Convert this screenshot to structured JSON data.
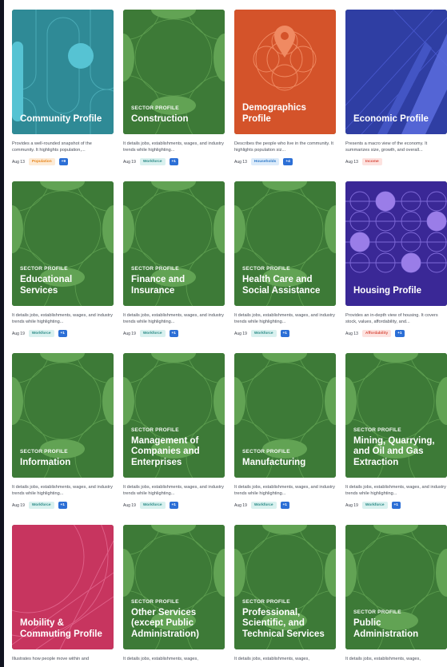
{
  "cards": [
    {
      "kicker": "",
      "title": "Community Profile",
      "desc": "Provides a well-rounded snapshot of the community. It highlights population,...",
      "date": "Aug 13",
      "tag": "Population",
      "tag_color": "#e8871e",
      "tag_bg": "#fdebd6",
      "plus": "+9",
      "theme": "community"
    },
    {
      "kicker": "SECTOR PROFILE",
      "title": "Construction",
      "desc": "It details jobs, establishments, wages, and industry trends while highlighting...",
      "date": "Aug 19",
      "tag": "Workforce",
      "tag_color": "#2a8a86",
      "tag_bg": "#d9f1ef",
      "plus": "+1",
      "theme": "sector"
    },
    {
      "kicker": "",
      "title": "Demographics Profile",
      "desc": "Describes the people who live in the community. It highlights population siz...",
      "date": "Aug 13",
      "tag": "Households",
      "tag_color": "#2e79c7",
      "tag_bg": "#dcebfa",
      "plus": "+4",
      "theme": "demographics"
    },
    {
      "kicker": "",
      "title": "Economic Profile",
      "desc": "Presents a macro view of the economy. It summarizes size, growth, and overall...",
      "date": "Aug 13",
      "tag": "Income",
      "tag_color": "#d84c3f",
      "tag_bg": "#fde2df",
      "plus": "",
      "theme": "economic"
    },
    {
      "kicker": "SECTOR PROFILE",
      "title": "Educational Services",
      "desc": "It details jobs, establishments, wages, and industry trends while highlighting...",
      "date": "Aug 19",
      "tag": "Workforce",
      "tag_color": "#2a8a86",
      "tag_bg": "#d9f1ef",
      "plus": "+1",
      "theme": "sector"
    },
    {
      "kicker": "SECTOR PROFILE",
      "title": "Finance and Insurance",
      "desc": "It details jobs, establishments, wages, and industry trends while highlighting...",
      "date": "Aug 19",
      "tag": "Workforce",
      "tag_color": "#2a8a86",
      "tag_bg": "#d9f1ef",
      "plus": "+1",
      "theme": "sector"
    },
    {
      "kicker": "SECTOR PROFILE",
      "title": "Health Care and Social Assistance",
      "desc": "It details jobs, establishments, wages, and industry trends while highlighting...",
      "date": "Aug 19",
      "tag": "Workforce",
      "tag_color": "#2a8a86",
      "tag_bg": "#d9f1ef",
      "plus": "+1",
      "theme": "sector"
    },
    {
      "kicker": "",
      "title": "Housing Profile",
      "desc": "Provides an in-depth view of housing. It covers stock, values, affordability, and...",
      "date": "Aug 13",
      "tag": "Affordability",
      "tag_color": "#d84c3f",
      "tag_bg": "#fde2df",
      "plus": "+1",
      "theme": "housing"
    },
    {
      "kicker": "SECTOR PROFILE",
      "title": "Information",
      "desc": "It details jobs, establishments, wages, and industry trends while highlighting...",
      "date": "Aug 19",
      "tag": "Workforce",
      "tag_color": "#2a8a86",
      "tag_bg": "#d9f1ef",
      "plus": "+1",
      "theme": "sector"
    },
    {
      "kicker": "SECTOR PROFILE",
      "title": "Management of Companies and Enterprises",
      "desc": "It details jobs, establishments, wages, and industry trends while highlighting...",
      "date": "Aug 19",
      "tag": "Workforce",
      "tag_color": "#2a8a86",
      "tag_bg": "#d9f1ef",
      "plus": "+1",
      "theme": "sector"
    },
    {
      "kicker": "SECTOR PROFILE",
      "title": "Manufacturing",
      "desc": "It details jobs, establishments, wages, and industry trends while highlighting...",
      "date": "Aug 19",
      "tag": "Workforce",
      "tag_color": "#2a8a86",
      "tag_bg": "#d9f1ef",
      "plus": "+1",
      "theme": "sector"
    },
    {
      "kicker": "SECTOR PROFILE",
      "title": "Mining, Quarrying, and Oil and Gas Extraction",
      "desc": "It details jobs, establishments, wages, and industry trends while highlighting...",
      "date": "Aug 19",
      "tag": "Workforce",
      "tag_color": "#2a8a86",
      "tag_bg": "#d9f1ef",
      "plus": "+1",
      "theme": "sector"
    },
    {
      "kicker": "",
      "title": "Mobility & Commuting Profile",
      "desc": "Illustrates how people move within and",
      "date": "",
      "tag": "",
      "tag_color": "",
      "tag_bg": "",
      "plus": "",
      "theme": "mobility"
    },
    {
      "kicker": "SECTOR PROFILE",
      "title": "Other Services (except Public Administration)",
      "desc": "It details jobs, establishments, wages,",
      "date": "",
      "tag": "",
      "tag_color": "",
      "tag_bg": "",
      "plus": "",
      "theme": "sector"
    },
    {
      "kicker": "SECTOR PROFILE",
      "title": "Professional, Scientific, and Technical Services",
      "desc": "It details jobs, establishments, wages,",
      "date": "",
      "tag": "",
      "tag_color": "",
      "tag_bg": "",
      "plus": "",
      "theme": "sector"
    },
    {
      "kicker": "SECTOR PROFILE",
      "title": "Public Administration",
      "desc": "It details jobs, establishments, wages,",
      "date": "",
      "tag": "",
      "tag_color": "",
      "tag_bg": "",
      "plus": "",
      "theme": "sector"
    }
  ],
  "theme_colors": {
    "sector": "#3d7a37",
    "sector_light": "#62a354",
    "community": "#2f8a96",
    "demographics": "#d4532a",
    "economic": "#2f3ea3",
    "housing": "#3a2896",
    "mobility": "#c7355f"
  }
}
